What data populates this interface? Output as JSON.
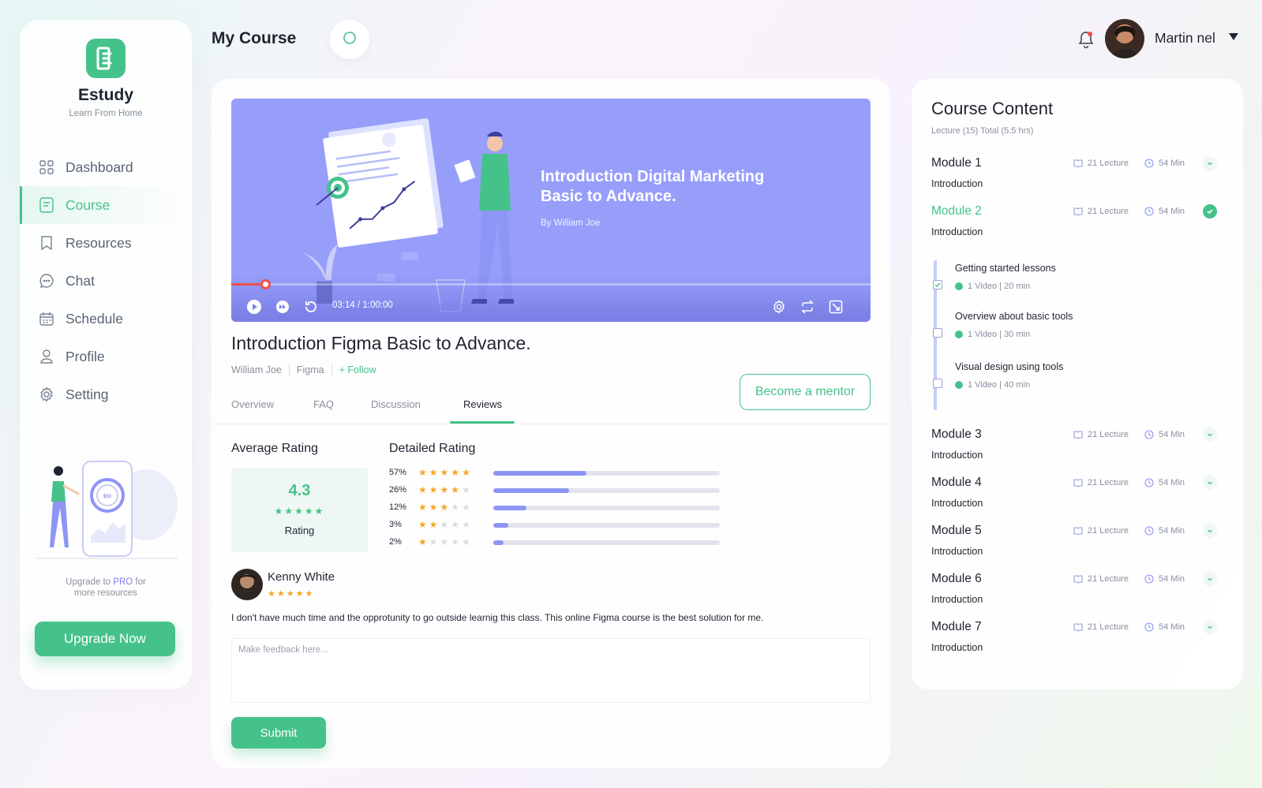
{
  "sidebar": {
    "brand": "Estudy",
    "tagline": "Learn From Home",
    "nav": [
      {
        "label": "Dashboard",
        "icon": "dashboard-icon",
        "active": false
      },
      {
        "label": "Course",
        "icon": "course-icon",
        "active": true
      },
      {
        "label": "Resources",
        "icon": "bookmark-icon",
        "active": false
      },
      {
        "label": "Chat",
        "icon": "chat-icon",
        "active": false
      },
      {
        "label": "Schedule",
        "icon": "calendar-icon",
        "active": false
      },
      {
        "label": "Profile",
        "icon": "user-icon",
        "active": false
      },
      {
        "label": "Setting",
        "icon": "gear-icon",
        "active": false
      }
    ],
    "upgrade_text_1": "Upgrade  to ",
    "upgrade_pro": "PRO",
    "upgrade_text_2": " for",
    "upgrade_text_3": "more resources",
    "upgrade_button": "Upgrade Now"
  },
  "header": {
    "title": "My Course",
    "user_name": "Martin nel"
  },
  "video": {
    "title": "Introduction Digital Marketing Basic to Advance.",
    "author": "By William Joe",
    "time": "03:14 / 1:00:00",
    "progress": 0.0537
  },
  "course": {
    "title": "Introduction Figma Basic to Advance.",
    "instructor": "William Joe",
    "category": "Figma",
    "follow": "+ Follow",
    "mentor_button": "Become a mentor"
  },
  "tabs": [
    {
      "label": "Overview",
      "active": false
    },
    {
      "label": "FAQ",
      "active": false
    },
    {
      "label": "Discussion",
      "active": false
    },
    {
      "label": "Reviews",
      "active": true
    }
  ],
  "ratings": {
    "average_heading": "Average Rating",
    "detailed_heading": "Detailed Rating",
    "average": "4.3",
    "average_label": "Rating",
    "rows": [
      {
        "pct": "57%",
        "stars": 5,
        "fill": 0.41
      },
      {
        "pct": "26%",
        "stars": 4,
        "fill": 0.335
      },
      {
        "pct": "12%",
        "stars": 3,
        "fill": 0.145
      },
      {
        "pct": "3%",
        "stars": 2,
        "fill": 0.065
      },
      {
        "pct": "2%",
        "stars": 1,
        "fill": 0.045
      }
    ]
  },
  "review": {
    "name": "Kenny White",
    "stars": 5,
    "text": "I don't have much time and the opprotunity to go outside learnig this class. This online Figma course is the best solution for me.",
    "feedback_placeholder": "Make feedback here...",
    "submit": "Submit"
  },
  "course_content": {
    "title": "Course Content",
    "subtitle": "Lecture (15)  Total (5.5 hrs)",
    "modules": [
      {
        "name": "Module 1",
        "intro": "Introduction",
        "lectures": "21 Lecture",
        "minutes": "54 Min",
        "open": false
      },
      {
        "name": "Module 2",
        "intro": "Introduction",
        "lectures": "21 Lecture",
        "minutes": "54 Min",
        "open": true
      },
      {
        "name": "Module 3",
        "intro": "Introduction",
        "lectures": "21 Lecture",
        "minutes": "54 Min",
        "open": false
      },
      {
        "name": "Module 4",
        "intro": "Introduction",
        "lectures": "21 Lecture",
        "minutes": "54 Min",
        "open": false
      },
      {
        "name": "Module 5",
        "intro": "Introduction",
        "lectures": "21 Lecture",
        "minutes": "54 Min",
        "open": false
      },
      {
        "name": "Module 6",
        "intro": "Introduction",
        "lectures": "21 Lecture",
        "minutes": "54 Min",
        "open": false
      },
      {
        "name": "Module 7",
        "intro": "Introduction",
        "lectures": "21 Lecture",
        "minutes": "54 Min",
        "open": false
      }
    ],
    "lessons": [
      {
        "name": "Getting started lessons",
        "meta": "1 Video | 20 min",
        "done": true
      },
      {
        "name": "Overview about basic tools",
        "meta": "1 Video | 30 min",
        "done": false
      },
      {
        "name": "Visual design using tools",
        "meta": "1 Video | 40 min",
        "done": false
      }
    ]
  },
  "colors": {
    "accent": "#45c28a",
    "video_bg": "#979efa",
    "star": "#f5a623",
    "bar": "#8d95f5"
  }
}
